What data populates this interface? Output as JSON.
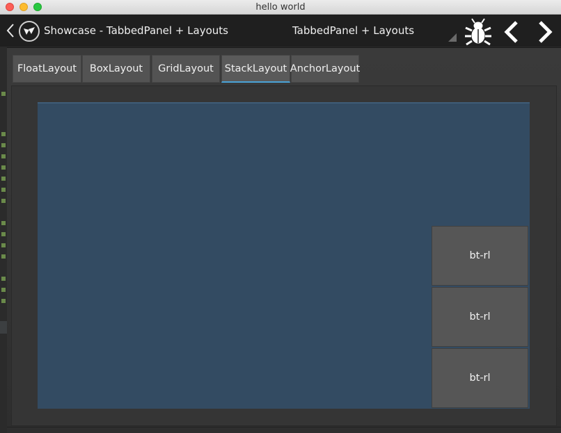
{
  "window": {
    "title": "hello world"
  },
  "actionbar": {
    "app_title": "Showcase - TabbedPanel + Layouts",
    "center_title": "TabbedPanel + Layouts"
  },
  "tabs": [
    {
      "label": "FloatLayout",
      "active": false
    },
    {
      "label": "BoxLayout",
      "active": false
    },
    {
      "label": "GridLayout",
      "active": false
    },
    {
      "label": "StackLayout",
      "active": true
    },
    {
      "label": "AnchorLayout",
      "active": false
    }
  ],
  "stack_buttons": [
    {
      "label": "bt-rl"
    },
    {
      "label": "bt-rl"
    },
    {
      "label": "bt-rl"
    }
  ],
  "colors": {
    "accent": "#4aa3d8",
    "stack_bg": "#334b62",
    "button_bg": "#565656"
  },
  "icons": {
    "back": "chevron-left-icon",
    "logo": "kivy-logo-icon",
    "dropdown": "dropdown-triangle-icon",
    "bug": "bug-icon",
    "prev": "chevron-left-icon",
    "next": "chevron-right-icon"
  }
}
